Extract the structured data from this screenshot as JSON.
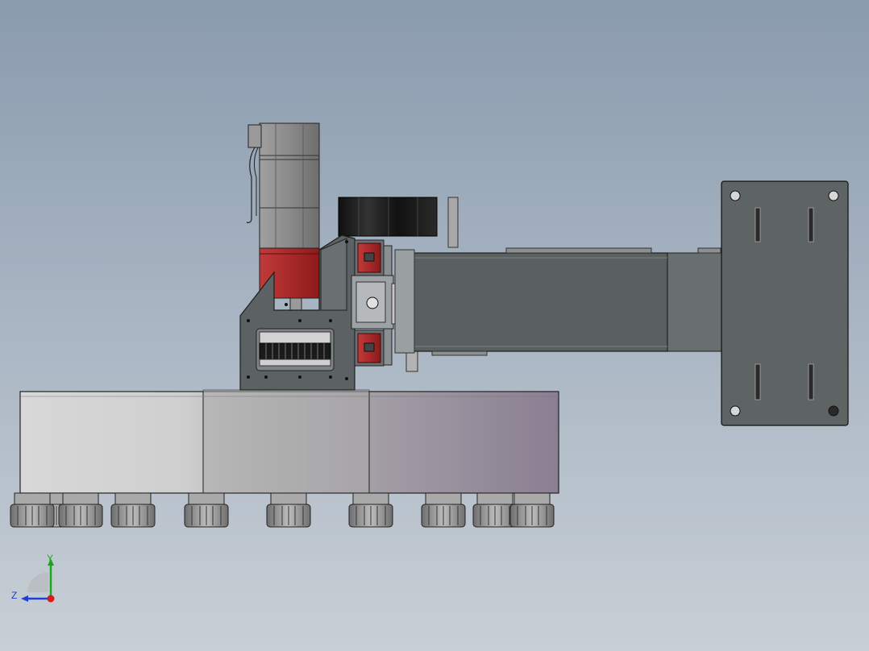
{
  "viewport": {
    "background_top": "#8a9bae",
    "background_bottom": "#c8cfd6"
  },
  "model": {
    "parts": [
      "servo-motor",
      "mounting-bracket",
      "timing-pulley",
      "linear-guide-rails",
      "linear-actuator-arm",
      "mounting-plate",
      "tool-magazine-disc",
      "er-collet-holders"
    ],
    "colors": {
      "motor_body": "#8c8c8c",
      "motor_red": "#b82828",
      "bracket": "#5c6163",
      "arm": "#5a5f60",
      "plate": "#5e6364",
      "disc_light": "#d6d6d6",
      "disc_purple": "#8e8494",
      "rail_red": "#b22222",
      "black_block": "#1c1c1c"
    },
    "collet_count": 10
  },
  "triad": {
    "y_label": "Y",
    "z_label": "Z",
    "icon": "coordinate-triad-icon",
    "colors": {
      "y": "#1aa81a",
      "z": "#1f3fd6",
      "x": "#d81b1b"
    }
  }
}
